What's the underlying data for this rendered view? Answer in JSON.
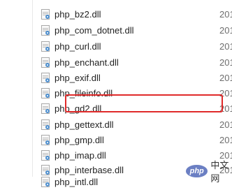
{
  "files": [
    {
      "name": "php_bz2.dll",
      "date": "201"
    },
    {
      "name": "php_com_dotnet.dll",
      "date": "201"
    },
    {
      "name": "php_curl.dll",
      "date": "201"
    },
    {
      "name": "php_enchant.dll",
      "date": "201"
    },
    {
      "name": "php_exif.dll",
      "date": "201"
    },
    {
      "name": "php_fileinfo.dll",
      "date": "201"
    },
    {
      "name": "php_gd2.dll",
      "date": "201"
    },
    {
      "name": "php_gettext.dll",
      "date": "201"
    },
    {
      "name": "php_gmp.dll",
      "date": "201"
    },
    {
      "name": "php_imap.dll",
      "date": "201"
    },
    {
      "name": "php_interbase.dll",
      "date": "201"
    },
    {
      "name": "php_intl.dll",
      "date": ""
    }
  ],
  "highlighted_file": "php_gd2.dll",
  "highlight_color": "#e02a2a",
  "watermark": {
    "logo": "php",
    "text": "中文网"
  },
  "icon": "dll-file-icon"
}
